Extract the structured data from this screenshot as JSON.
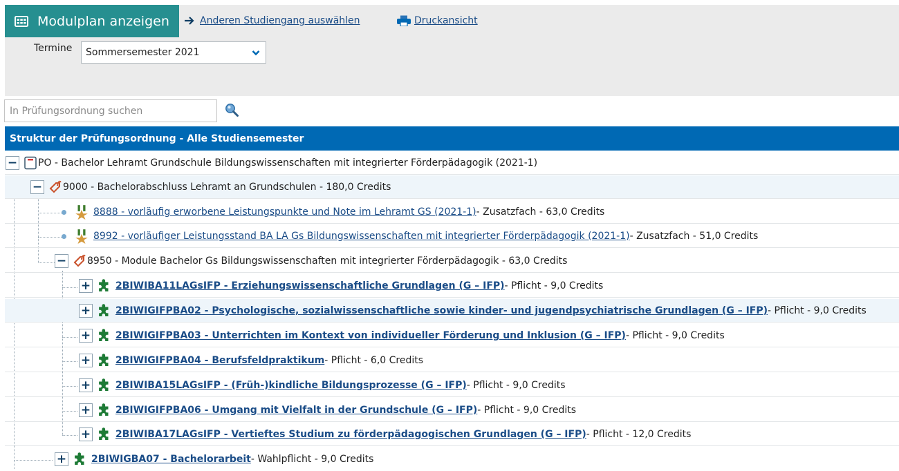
{
  "toolbar": {
    "active_tab": "Modulplan anzeigen",
    "change_program": "Anderen Studiengang auswählen",
    "print_view": "Druckansicht"
  },
  "termine": {
    "label": "Termine",
    "selected": "Sommersemester 2021"
  },
  "search": {
    "placeholder": "In Prüfungsordnung suchen"
  },
  "tree": {
    "header": "Struktur der Prüfungsordnung - Alle Studiensemester",
    "nodes": [
      {
        "id": "po",
        "text": "PO - Bachelor Lehramt Grundschule Bildungswissenschaften mit integrierter Förderpädagogik (2021-1)",
        "toggle": "−"
      },
      {
        "id": "n9000",
        "text": "9000 - Bachelorabschluss Lehramt an Grundschulen - 180,0 Credits",
        "toggle": "−"
      },
      {
        "id": "n8888",
        "link": "8888 - vorläufig erworbene Leistungspunkte und Note im Lehramt GS (2021-1)",
        "suffix": " - Zusatzfach - 63,0 Credits"
      },
      {
        "id": "n8992",
        "link": "8992 - vorläufiger Leistungsstand BA LA Gs Bildungswissenschaften mit integrierter Förderpädagogik (2021-1)",
        "suffix": " - Zusatzfach - 51,0 Credits"
      },
      {
        "id": "n8950",
        "text": "8950 - Module Bachelor Gs Bildungswissenschaften mit integrierter Förderpädagogik - 63,0 Credits",
        "toggle": "−"
      },
      {
        "id": "m1",
        "link": "2BIWIBA11LAGsIFP - Erziehungswissenschaftliche Grundlagen (G – IFP)",
        "suffix": " - Pflicht - 9,0 Credits",
        "toggle": "+"
      },
      {
        "id": "m2",
        "link": "2BIWIGIFPBA02 - Psychologische, sozialwissenschaftliche sowie kinder- und jugendpsychiatrische Grundlagen (G – IFP)",
        "suffix": " - Pflicht - 9,0 Credits",
        "toggle": "+"
      },
      {
        "id": "m3",
        "link": "2BIWIGIFPBA03 - Unterrichten im Kontext von individueller Förderung und Inklusion (G – IFP)",
        "suffix": " - Pflicht - 9,0 Credits",
        "toggle": "+"
      },
      {
        "id": "m4",
        "link": "2BIWIGIFPBA04 - Berufsfeldpraktikum",
        "suffix": " - Pflicht - 6,0 Credits",
        "toggle": "+"
      },
      {
        "id": "m5",
        "link": "2BIWIBA15LAGsIFP - (Früh-)kindliche Bildungsprozesse (G – IFP)",
        "suffix": " - Pflicht - 9,0 Credits",
        "toggle": "+"
      },
      {
        "id": "m6",
        "link": "2BIWIGIFPBA06 - Umgang mit Vielfalt in der Grundschule (G – IFP)",
        "suffix": " - Pflicht - 9,0 Credits",
        "toggle": "+"
      },
      {
        "id": "m7",
        "link": "2BIWIBA17LAGsIFP - Vertieftes Studium zu förderpädagogischen Grundlagen (G – IFP)",
        "suffix": " - Pflicht - 12,0 Credits",
        "toggle": "+"
      },
      {
        "id": "m8",
        "link": "2BIWIGBA07 - Bachelorarbeit",
        "suffix": " - Wahlpflicht - 9,0 Credits",
        "toggle": "+"
      }
    ]
  },
  "colors": {
    "tab": "#268f90",
    "header": "#0069b4",
    "link": "#1a4c87",
    "puzzle": "#1e7b36"
  }
}
